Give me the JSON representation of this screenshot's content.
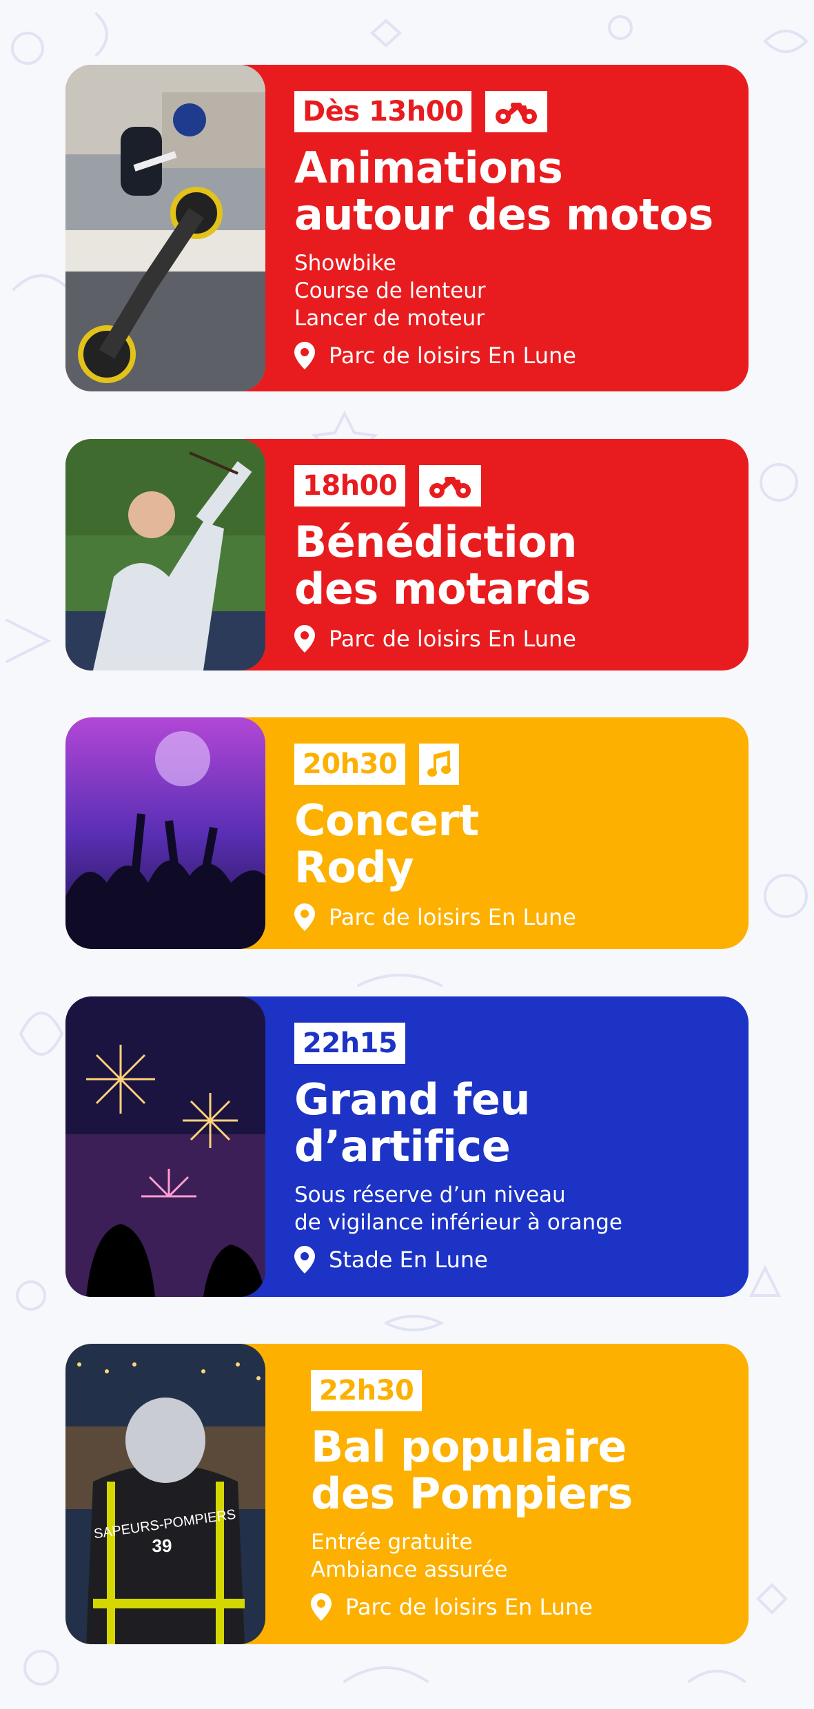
{
  "colors": {
    "red": "#e81c1f",
    "yellow": "#fdb000",
    "blue": "#1c33c5",
    "background": "#f7f8fc"
  },
  "events": [
    {
      "time": "Dès 13h00",
      "icon": "motorcycle-icon",
      "title": "Animations\nautour des motos",
      "description": "Showbike\nCourse de lenteur\nLancer de moteur",
      "location": "Parc de loisirs En Lune"
    },
    {
      "time": "18h00",
      "icon": "motorcycle-icon",
      "title": "Bénédiction\ndes motards",
      "location": "Parc de loisirs En Lune"
    },
    {
      "time": "20h30",
      "icon": "music-note-icon",
      "title": "Concert\nRody",
      "location": "Parc de loisirs En Lune"
    },
    {
      "time": "22h15",
      "title": "Grand feu\nd’artifice",
      "description": "Sous réserve d’un niveau\nde vigilance inférieur à orange",
      "location": "Stade En Lune"
    },
    {
      "time": "22h30",
      "title": "Bal populaire\ndes Pompiers",
      "description": "Entrée gratuite\nAmbiance assurée",
      "location": "Parc de loisirs En Lune",
      "photo_text": {
        "line1": "SAPEURS-POMPIERS",
        "line2": "39"
      }
    }
  ]
}
